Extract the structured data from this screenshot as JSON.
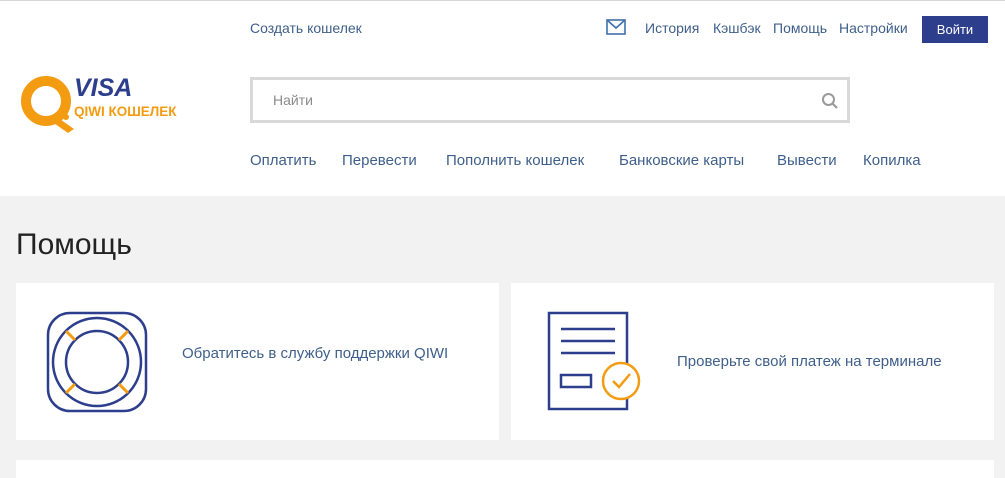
{
  "header": {
    "create_wallet": "Создать кошелек",
    "top_links": [
      "История",
      "Кэшбэк",
      "Помощь",
      "Настройки"
    ],
    "login_label": "Войти",
    "logo": {
      "brand_visa": "VISA",
      "brand_sub": "QIWI КОШЕЛЕК"
    },
    "search": {
      "placeholder": "Найти"
    },
    "nav": [
      "Оплатить",
      "Перевести",
      "Пополнить кошелек",
      "Банковские карты",
      "Вывести",
      "Копилка"
    ]
  },
  "main": {
    "title": "Помощь",
    "cards": [
      {
        "text": "Обратитесь в службу поддержки QIWI",
        "icon": "lifebuoy-icon"
      },
      {
        "text": "Проверьте свой платеж на терминале",
        "icon": "receipt-check-icon"
      }
    ]
  },
  "colors": {
    "accent": "#2c3e8c",
    "link": "#3f5f8a",
    "brand_orange": "#f39c12",
    "page_bg": "#f2f2f2"
  }
}
